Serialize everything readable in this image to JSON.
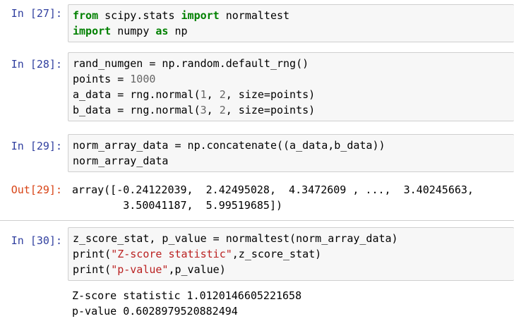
{
  "cells": [
    {
      "prompt": "In [27]:",
      "lines": [
        [
          {
            "t": "from",
            "c": "kw"
          },
          {
            "t": " scipy.stats ",
            "c": ""
          },
          {
            "t": "import",
            "c": "kw"
          },
          {
            "t": " normaltest",
            "c": ""
          }
        ],
        [
          {
            "t": "import",
            "c": "kw"
          },
          {
            "t": " numpy ",
            "c": ""
          },
          {
            "t": "as",
            "c": "kw"
          },
          {
            "t": " np",
            "c": ""
          }
        ]
      ]
    },
    {
      "prompt": "In [28]:",
      "lines": [
        [
          {
            "t": "rand_numgen = np.random.default_rng()",
            "c": ""
          }
        ],
        [
          {
            "t": "points = ",
            "c": ""
          },
          {
            "t": "1000",
            "c": "num"
          }
        ],
        [
          {
            "t": "a_data = rng.normal(",
            "c": ""
          },
          {
            "t": "1",
            "c": "num"
          },
          {
            "t": ", ",
            "c": ""
          },
          {
            "t": "2",
            "c": "num"
          },
          {
            "t": ", size=points)",
            "c": ""
          }
        ],
        [
          {
            "t": "b_data = rng.normal(",
            "c": ""
          },
          {
            "t": "3",
            "c": "num"
          },
          {
            "t": ", ",
            "c": ""
          },
          {
            "t": "2",
            "c": "num"
          },
          {
            "t": ", size=points)",
            "c": ""
          }
        ]
      ]
    },
    {
      "prompt": "In [29]:",
      "lines": [
        [
          {
            "t": "norm_array_data = np.concatenate((a_data,b_data))",
            "c": ""
          }
        ],
        [
          {
            "t": "norm_array_data",
            "c": ""
          }
        ]
      ],
      "out_prompt": "Out[29]:",
      "output": [
        "array([-0.24122039,  2.42495028,  4.3472609 , ...,  3.40245663,",
        "        3.50041187,  5.99519685])"
      ]
    },
    {
      "prompt": "In [30]:",
      "lines": [
        [
          {
            "t": "z_score_stat, p_value = normaltest(norm_array_data)",
            "c": ""
          }
        ],
        [
          {
            "t": "print(",
            "c": ""
          },
          {
            "t": "\"Z-score statistic\"",
            "c": "str"
          },
          {
            "t": ",z_score_stat)",
            "c": ""
          }
        ],
        [
          {
            "t": "print(",
            "c": ""
          },
          {
            "t": "\"p-value\"",
            "c": "str"
          },
          {
            "t": ",p_value)",
            "c": ""
          }
        ]
      ],
      "output": [
        "Z-score statistic 1.0120146605221658",
        "p-value 0.6028979520882494"
      ]
    }
  ]
}
